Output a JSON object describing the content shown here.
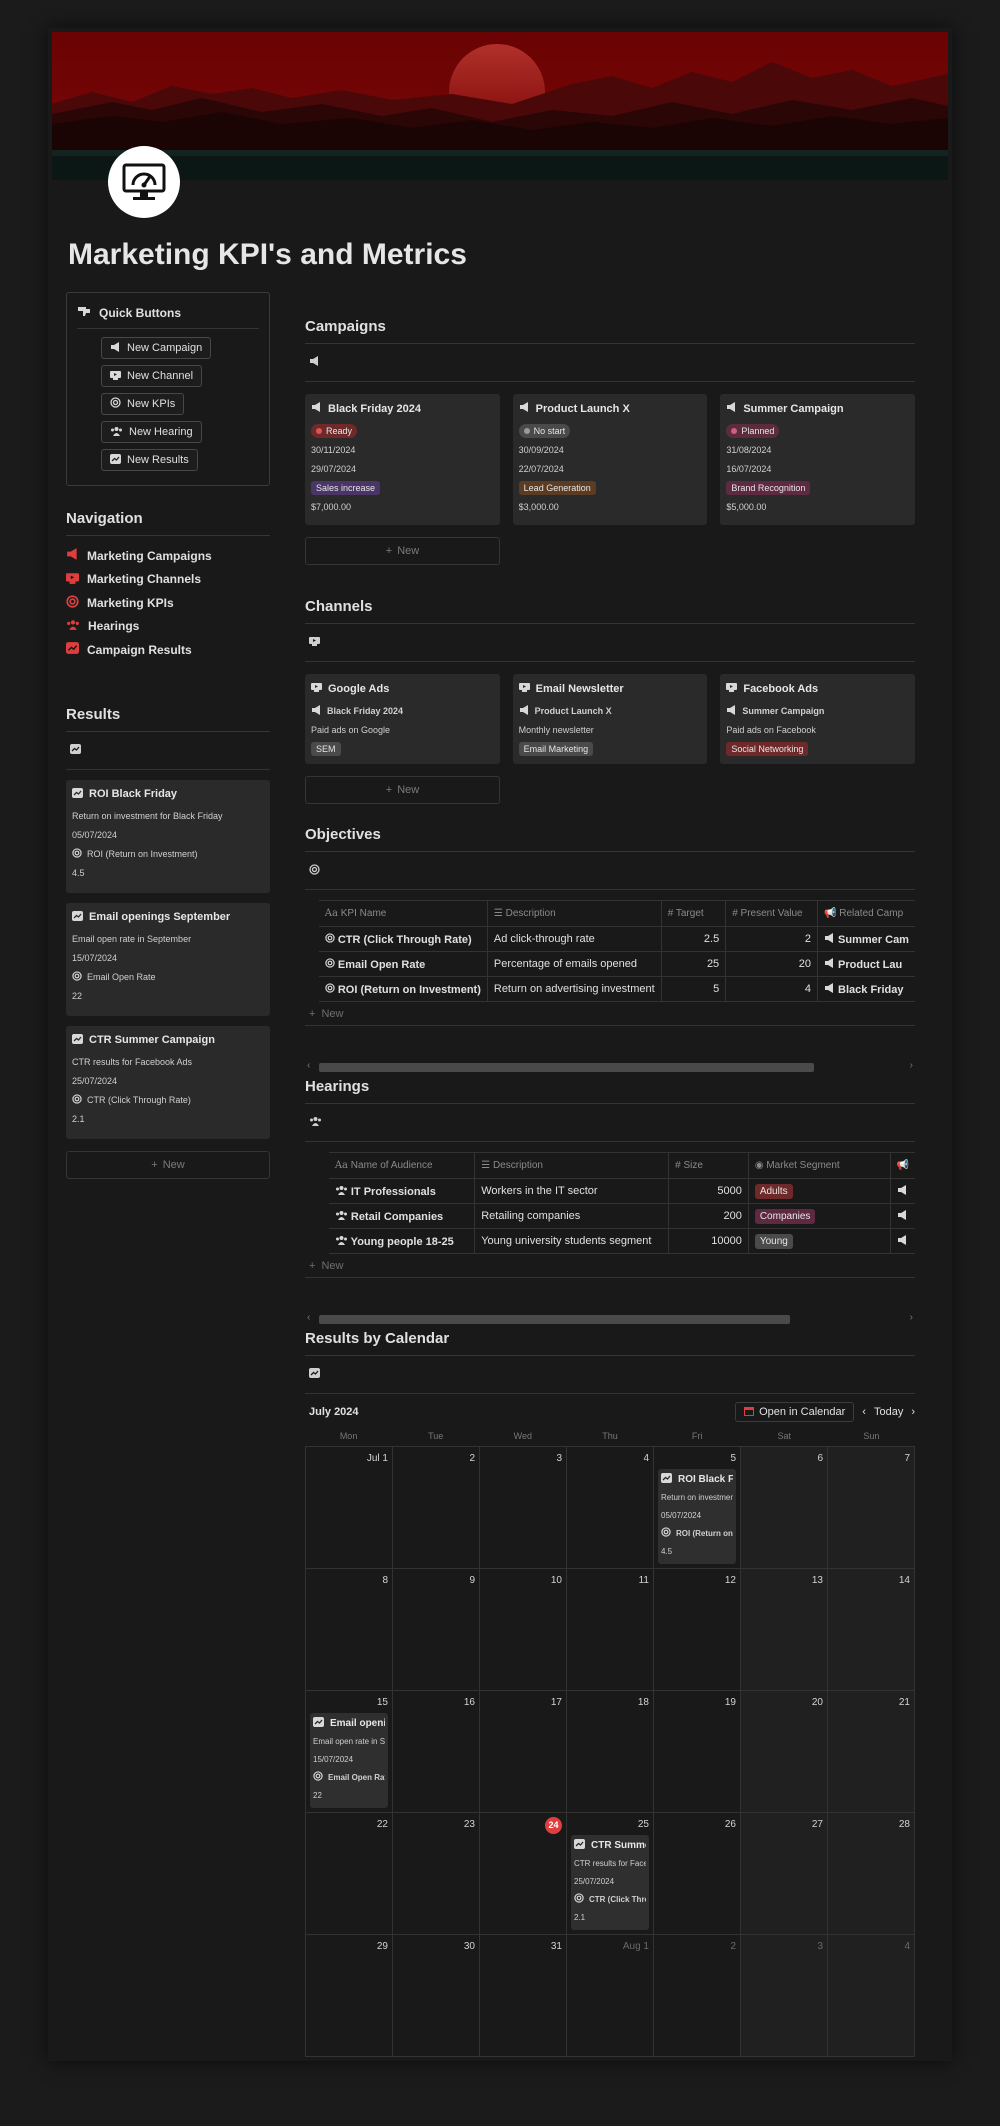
{
  "page": {
    "title": "Marketing KPI's and Metrics"
  },
  "quick_buttons": {
    "title": "Quick Buttons",
    "buttons": [
      "New Campaign",
      "New Channel",
      "New KPIs",
      "New Hearing",
      "New Results"
    ]
  },
  "navigation": {
    "title": "Navigation",
    "items": [
      "Marketing Campaigns",
      "Marketing Channels",
      "Marketing KPIs",
      "Hearings",
      "Campaign Results"
    ]
  },
  "results": {
    "title": "Results",
    "cards": [
      {
        "title": "ROI Black Friday",
        "desc": "Return on investment for Black Friday",
        "date": "05/07/2024",
        "kpi": "ROI (Return on Investment)",
        "value": "4.5"
      },
      {
        "title": "Email openings September",
        "desc": "Email open rate in September",
        "date": "15/07/2024",
        "kpi": "Email Open Rate",
        "value": "22"
      },
      {
        "title": "CTR Summer Campaign",
        "desc": "CTR results for Facebook Ads",
        "date": "25/07/2024",
        "kpi": "CTR (Click Through Rate)",
        "value": "2.1"
      }
    ],
    "new_label": "New"
  },
  "campaigns": {
    "title": "Campaigns",
    "cards": [
      {
        "title": "Black Friday 2024",
        "status": "Ready",
        "date1": "30/11/2024",
        "date2": "29/07/2024",
        "tag": "Sales increase",
        "amount": "$7,000.00"
      },
      {
        "title": "Product Launch X",
        "status": "No start",
        "date1": "30/09/2024",
        "date2": "22/07/2024",
        "tag": "Lead Generation",
        "amount": "$3,000.00"
      },
      {
        "title": "Summer Campaign",
        "status": "Planned",
        "date1": "31/08/2024",
        "date2": "16/07/2024",
        "tag": "Brand Recognition",
        "amount": "$5,000.00"
      }
    ],
    "new_label": "New"
  },
  "channels": {
    "title": "Channels",
    "cards": [
      {
        "title": "Google Ads",
        "campaign": "Black Friday 2024",
        "desc": "Paid ads on Google",
        "tag": "SEM"
      },
      {
        "title": "Email Newsletter",
        "campaign": "Product Launch X",
        "desc": "Monthly newsletter",
        "tag": "Email Marketing"
      },
      {
        "title": "Facebook Ads",
        "campaign": "Summer Campaign",
        "desc": "Paid ads on Facebook",
        "tag": "Social Networking"
      }
    ],
    "new_label": "New"
  },
  "objectives": {
    "title": "Objectives",
    "columns": [
      "KPI Name",
      "Description",
      "Target",
      "Present Value",
      "Related Camp"
    ],
    "rows": [
      {
        "name": "CTR (Click Through Rate)",
        "desc": "Ad click-through rate",
        "target": "2.5",
        "present": "2",
        "related": "Summer Cam"
      },
      {
        "name": "Email Open Rate",
        "desc": "Percentage of emails opened",
        "target": "25",
        "present": "20",
        "related": "Product Lau"
      },
      {
        "name": "ROI (Return on Investment)",
        "desc": "Return on advertising investment",
        "target": "5",
        "present": "4",
        "related": "Black Friday"
      }
    ],
    "new_label": "New",
    "scroll_fraction": 0.85
  },
  "hearings": {
    "title": "Hearings",
    "columns": [
      "Name of Audience",
      "Description",
      "Size",
      "Market Segment"
    ],
    "rows": [
      {
        "name": "IT Professionals",
        "desc": "Workers in the IT sector",
        "size": "5000",
        "segment": "Adults"
      },
      {
        "name": "Retail Companies",
        "desc": "Retailing companies",
        "size": "200",
        "segment": "Companies"
      },
      {
        "name": "Young people 18-25",
        "desc": "Young university students segment",
        "size": "10000",
        "segment": "Young"
      }
    ],
    "new_label": "New",
    "scroll_fraction": 0.81
  },
  "calendar": {
    "title": "Results by Calendar",
    "month": "July 2024",
    "open_label": "Open in Calendar",
    "today_label": "Today",
    "weekdays": [
      "Mon",
      "Tue",
      "Wed",
      "Thu",
      "Fri",
      "Sat",
      "Sun"
    ],
    "weeks": [
      [
        "Jul 1",
        "2",
        "3",
        "4",
        "5",
        "6",
        "7"
      ],
      [
        "8",
        "9",
        "10",
        "11",
        "12",
        "13",
        "14"
      ],
      [
        "15",
        "16",
        "17",
        "18",
        "19",
        "20",
        "21"
      ],
      [
        "22",
        "23",
        "24",
        "25",
        "26",
        "27",
        "28"
      ],
      [
        "29",
        "30",
        "31",
        "Aug 1",
        "2",
        "3",
        "4"
      ]
    ],
    "today": "24",
    "events": [
      {
        "week": 0,
        "day": 4,
        "title": "ROI Black Friday",
        "desc": "Return on investment",
        "date": "05/07/2024",
        "kpi": "ROI (Return on Investment)",
        "value": "4.5"
      },
      {
        "week": 2,
        "day": 0,
        "title": "Email openings September",
        "desc": "Email open rate in September",
        "date": "15/07/2024",
        "kpi": "Email Open Rate",
        "value": "22"
      },
      {
        "week": 3,
        "day": 3,
        "title": "CTR Summer Campaign",
        "desc": "CTR results for Facebook Ads",
        "date": "25/07/2024",
        "kpi": "CTR (Click Through Rate)",
        "value": "2.1"
      }
    ]
  },
  "colors": {
    "accent_red": "#e03e3e",
    "status_ready": "#6e2a2a",
    "status_nostart": "#4a4a4a",
    "status_planned": "#5b2c3c",
    "tag_purple": "#4a3566",
    "tag_brown": "#5c3b23",
    "tag_pink": "#5e2a42",
    "tag_gray": "#4a4a4a",
    "tag_red": "#6e2a2a"
  }
}
